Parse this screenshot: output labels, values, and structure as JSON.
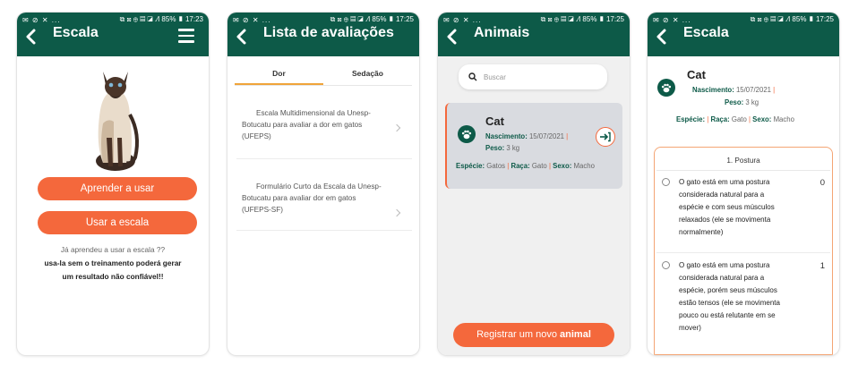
{
  "status": {
    "left": "✉ ⊘ ✕ ...",
    "right": "⧉ ⊠ ⊕ ▤ ◪ .⁄l 85% ▮ 17:23",
    "right_alt": "⧉ ⊠ ⊕ ▤ ◪ .⁄l 85% ▮ 17:25"
  },
  "screen1": {
    "title": "Escala",
    "learn_button": "Aprender a usar",
    "use_button": "Usar a escala",
    "note_line1": "Já aprendeu a usar a escala ??",
    "note_line2": "usa-la sem o treinamento poderá gerar",
    "note_line3": "um resultado não confiável!!"
  },
  "screen2": {
    "title": "Lista de avaliações",
    "tabs": [
      "Dor",
      "Sedação"
    ],
    "items": [
      {
        "line1": "Escala Multidimensional da Unesp-",
        "line2": "Botucatu para avaliar a dor em gatos",
        "line3": "(UFEPS)"
      },
      {
        "line1": "Formulário Curto da Escala da Unesp-",
        "line2": "Botucatu para avaliar dor em gatos",
        "line3": "(UFEPS-SF)"
      }
    ]
  },
  "screen3": {
    "title": "Animais",
    "search_placeholder": "Buscar",
    "animal": {
      "name": "Cat",
      "birth_label": "Nascimento:",
      "birth_value": "15/07/2021",
      "weight_label": "Peso:",
      "weight_value": "3 kg",
      "species_label": "Espécie:",
      "species_value": "Gatos",
      "breed_label": "Raça:",
      "breed_value": "Gato",
      "sex_label": "Sexo:",
      "sex_value": "Macho"
    },
    "register_button": "Registrar um novo",
    "register_button_bold": "animal"
  },
  "screen4": {
    "title": "Escala",
    "animal": {
      "name": "Cat",
      "birth_label": "Nascimento:",
      "birth_value": "15/07/2021",
      "weight_label": "Peso:",
      "weight_value": "3 kg",
      "species_label": "Espécie:",
      "breed_label": "Raça:",
      "breed_value": "Gato",
      "sex_label": "Sexo:",
      "sex_value": "Macho"
    },
    "section": "1. Postura",
    "options": [
      {
        "lines": [
          "O gato está em uma postura",
          "considerada natural para a",
          "espécie e com seus músculos",
          "relaxados (ele se movimenta",
          "normalmente)"
        ],
        "score": "0"
      },
      {
        "lines": [
          "O gato está em uma postura",
          "considerada natural para a",
          "espécie, porém seus músculos",
          "estão tensos (ele se movimenta",
          "pouco ou está relutante em se",
          "mover)"
        ],
        "score": "1"
      }
    ]
  },
  "colors": {
    "primary": "#0d5a48",
    "accent": "#f4683c",
    "card": "#d9dbe0",
    "tab_underline": "#f0a43a"
  }
}
